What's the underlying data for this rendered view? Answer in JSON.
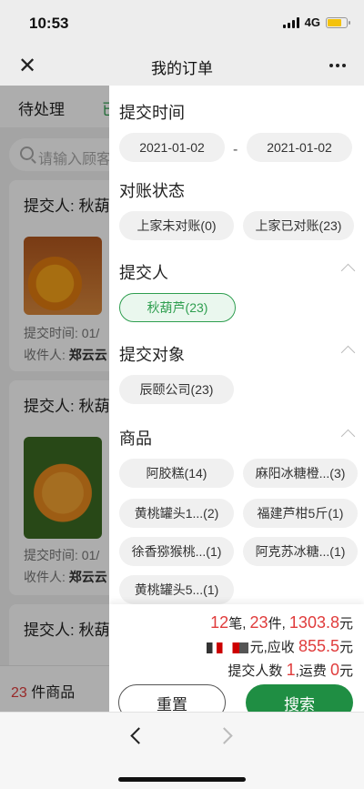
{
  "status_bar": {
    "time": "10:53",
    "network": "4G",
    "battery_level": 0.75
  },
  "nav": {
    "title": "我的订单"
  },
  "page": {
    "tabs": [
      "待处理",
      "已"
    ],
    "search_placeholder": "请输入顾客",
    "orders": [
      {
        "submitter": "提交人: 秋葫",
        "time_label": "提交时间: 01/",
        "receiver_label": "收件人:",
        "receiver": "郑云云"
      },
      {
        "submitter": "提交人: 秋葫",
        "time_label": "提交时间: 01/",
        "receiver_label": "收件人:",
        "receiver": "郑云云"
      },
      {
        "submitter": "提交人: 秋葫"
      }
    ],
    "cart": {
      "count": "23",
      "label": "件商品"
    }
  },
  "filter": {
    "submit_time": {
      "title": "提交时间",
      "start": "2021-01-02",
      "separator": "-",
      "end": "2021-01-02"
    },
    "reconcile": {
      "title": "对账状态",
      "options": [
        "上家未对账(0)",
        "上家已对账(23)"
      ]
    },
    "submitter": {
      "title": "提交人",
      "options": [
        "秋葫芦(23)"
      ]
    },
    "target": {
      "title": "提交对象",
      "options": [
        "辰颐公司(23)"
      ]
    },
    "products": {
      "title": "商品",
      "options": [
        "阿胶糕(14)",
        "麻阳冰糖橙...(3)",
        "黄桃罐头1...(2)",
        "福建芦柑5斤(1)",
        "徐香猕猴桃...(1)",
        "阿克苏冰糖...(1)",
        "黄桃罐头5...(1)"
      ]
    }
  },
  "summary": {
    "orders_count": "12",
    "orders_unit": "笔,",
    "items_count": "23",
    "items_unit": "件,",
    "amount": "1303.8",
    "amount_unit": "元",
    "paid_unit": "元,应收",
    "receivable": "855.5",
    "receivable_unit": "元",
    "submitters_label": "提交人数",
    "submitters_count": "1",
    "shipping_label": ",运费",
    "shipping": "0",
    "shipping_unit": "元"
  },
  "buttons": {
    "reset": "重置",
    "search": "搜索"
  },
  "colors": {
    "accent_green": "#2e9e4f",
    "search_button": "#1f8e43",
    "highlight_red": "#e03c3c"
  }
}
